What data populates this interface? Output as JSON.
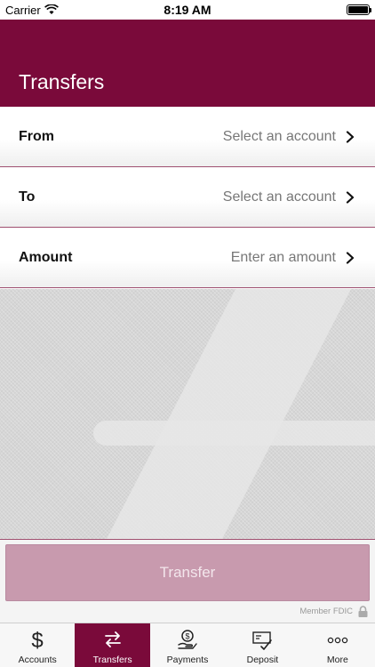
{
  "status_bar": {
    "carrier": "Carrier",
    "time": "8:19 AM"
  },
  "header": {
    "title": "Transfers"
  },
  "form": {
    "rows": [
      {
        "label": "From",
        "value": "Select an account"
      },
      {
        "label": "To",
        "value": "Select an account"
      },
      {
        "label": "Amount",
        "value": "Enter an amount"
      }
    ]
  },
  "transfer_button": {
    "label": "Transfer"
  },
  "footer": {
    "member_fdic": "Member FDIC"
  },
  "tabbar": {
    "tabs": [
      {
        "label": "Accounts",
        "icon": "dollar-icon"
      },
      {
        "label": "Transfers",
        "icon": "transfer-arrows-icon",
        "active": true
      },
      {
        "label": "Payments",
        "icon": "payment-hand-icon"
      },
      {
        "label": "Deposit",
        "icon": "check-deposit-icon"
      },
      {
        "label": "More",
        "icon": "more-dots-icon"
      }
    ]
  },
  "colors": {
    "brand": "#7a0a3a",
    "button_disabled": "#c89aae",
    "row_divider": "#a05070"
  }
}
